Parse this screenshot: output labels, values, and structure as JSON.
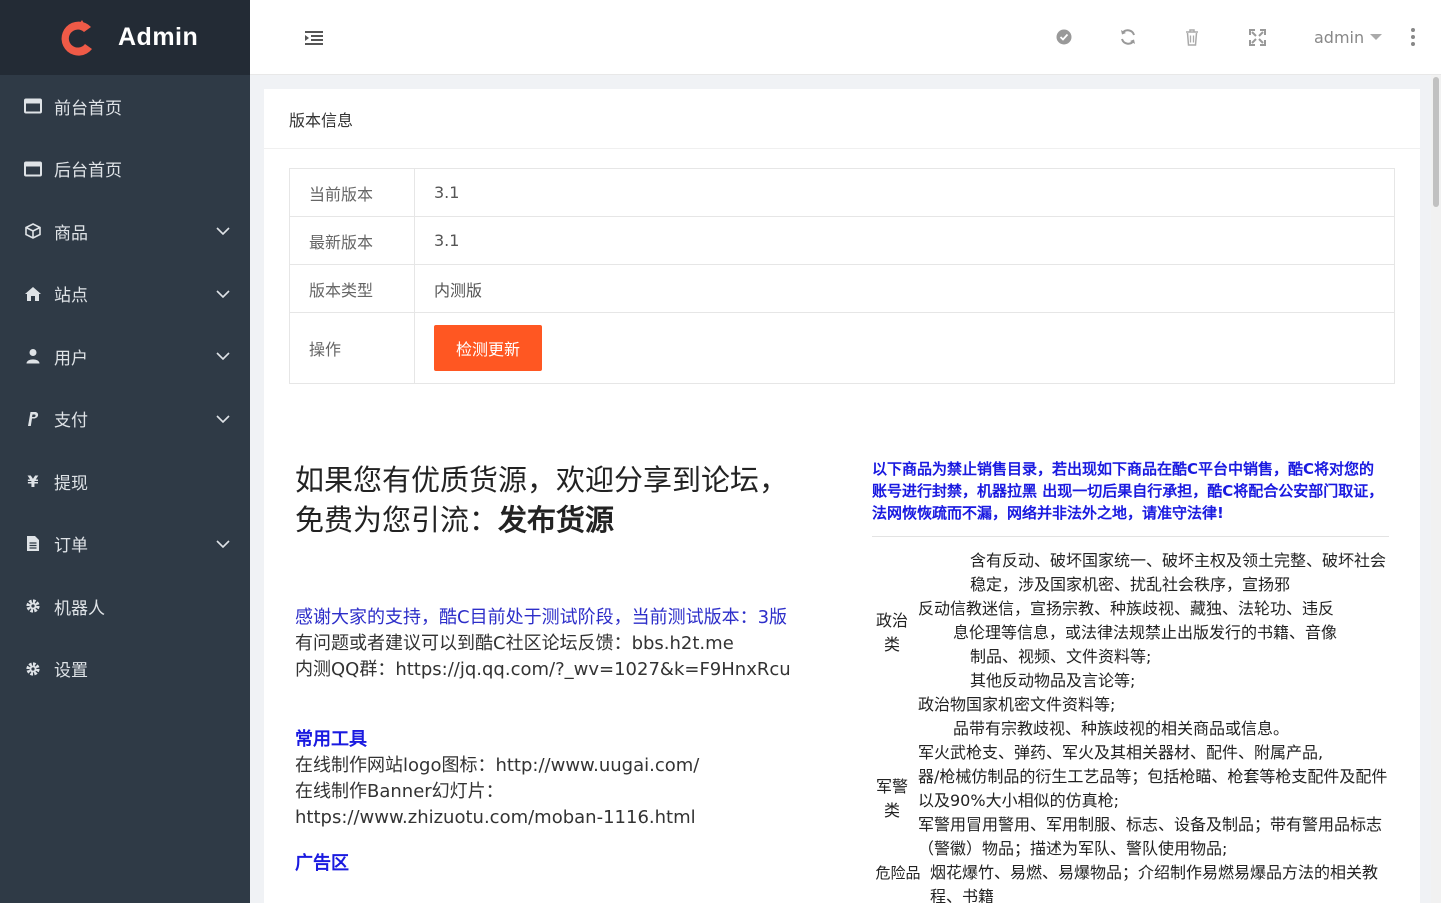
{
  "app": {
    "title": "Admin"
  },
  "colors": {
    "sidebar": "#2f3a46",
    "logo_bg": "#232b35",
    "accent": "#ff5722",
    "link_blue": "#1a1ae0",
    "logo_mark": "#ef5a47"
  },
  "sidebar": {
    "items": [
      {
        "label": "前台首页",
        "icon": "window-icon",
        "has_children": false
      },
      {
        "label": "后台首页",
        "icon": "window-icon",
        "has_children": false
      },
      {
        "label": "商品",
        "icon": "cube-icon",
        "has_children": true
      },
      {
        "label": "站点",
        "icon": "home-icon",
        "has_children": true
      },
      {
        "label": "用户",
        "icon": "user-icon",
        "has_children": true
      },
      {
        "label": "支付",
        "icon": "paypal-icon",
        "has_children": true
      },
      {
        "label": "提现",
        "icon": "yen-icon",
        "has_children": false
      },
      {
        "label": "订单",
        "icon": "document-icon",
        "has_children": true
      },
      {
        "label": "机器人",
        "icon": "gear-icon",
        "has_children": false
      },
      {
        "label": "设置",
        "icon": "gear-icon",
        "has_children": false
      }
    ]
  },
  "topbar": {
    "user": "admin"
  },
  "version_card": {
    "title": "版本信息",
    "rows": [
      {
        "key": "当前版本",
        "value": "3.1"
      },
      {
        "key": "最新版本",
        "value": "3.1"
      },
      {
        "key": "版本类型",
        "value": "内测版"
      }
    ],
    "action_key": "操作",
    "action_button": "检测更新"
  },
  "info": {
    "headline_line1": "如果您有优质货源，欢迎分享到论坛，",
    "headline_line2_prefix": "免费为您引流：",
    "headline_link": "发布货源",
    "thanks": "感谢大家的支持，酷C目前处于测试阶段，当前测试版本：3版",
    "feedback": "有问题或者建议可以到酷C社区论坛反馈：bbs.h2t.me",
    "qq_group": "内测QQ群：https://jq.qq.com/?_wv=1027&k=F9HnxRcu",
    "tools_title": "常用工具",
    "tool1": "在线制作网站logo图标：http://www.uugai.com/",
    "tool2_label": "在线制作Banner幻灯片：",
    "tool2_url": "https://www.zhizuotu.com/moban-1116.html",
    "ads_title": "广告区"
  },
  "prohibited": {
    "warning": "以下商品为禁止销售目录，若出现如下商品在酷C平台中销售，酷C将对您的账号进行封禁，机器拉黑 出现一切后果自行承担，酷C将配合公安部门取证，法网恢恢疏而不漏，网络并非法外之地，请准守法律!",
    "categories": [
      {
        "label": "政治类",
        "lines": [
          "含有反动、破坏国家统一、破坏主权及领土完整、破坏社会稳定，涉及国家机密、扰乱社会秩序，宣扬邪",
          "反动信教迷信，宣扬宗教、种族歧视、藏独、法轮功、违反",
          "息伦理等信息，或法律法规禁止出版发行的书籍、音像",
          "制品、视频、文件资料等;",
          "其他反动物品及言论等;",
          "政治物国家机密文件资料等;",
          "品带有宗教歧视、种族歧视的相关商品或信息。"
        ]
      },
      {
        "label": "军警类",
        "lines": [
          "军火武枪支、弹药、军火及其相关器材、配件、附属产品,",
          "器/枪械仿制品的衍生工艺品等；包括枪瞄、枪套等枪支配件及配件以及90%大小相似的仿真枪;",
          "军警用冒用警用、军用制服、标志、设备及制品；带有警用品标志（警徽）物品；描述为军队、警队使用物品;"
        ]
      },
      {
        "label": "危险品",
        "lines": [
          "烟花爆竹、易燃、易爆物品；介绍制作易燃易爆品方法的相关教程、书籍"
        ]
      }
    ]
  }
}
